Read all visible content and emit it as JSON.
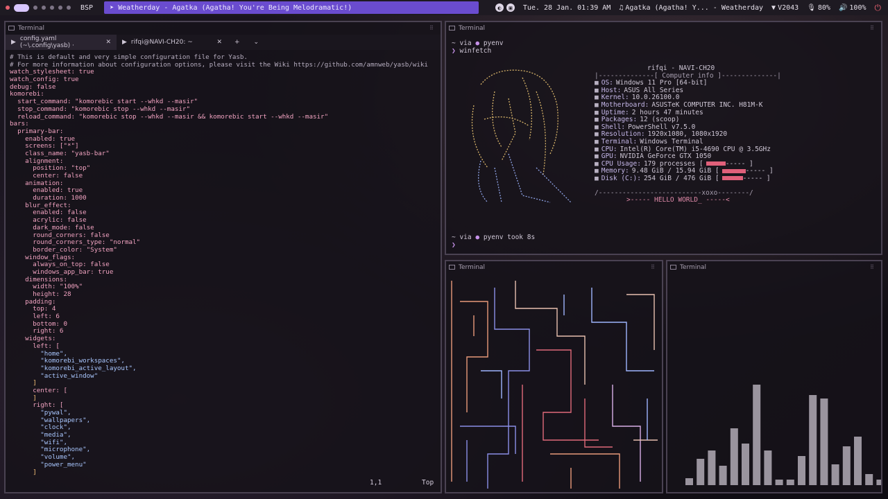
{
  "topbar": {
    "layout": "BSP",
    "active_window": "Weatherday - Agatka (Agatha! You're Being Melodramatic!)",
    "datetime": "Tue. 28 Jan. 01:39 AM",
    "media": "Agatka (Agatha! Y... - Weatherday",
    "wifi": "V2043",
    "mic": "80%",
    "volume": "100%"
  },
  "editor": {
    "title": "Terminal",
    "tabs": [
      {
        "label": "config.yaml (~\\.config\\yasb) ·"
      },
      {
        "label": "rifqi@NAVI-CH20: ~"
      }
    ],
    "lines": [
      "# This is default and very simple configuration file for Yasb.",
      "# For more information about configuration options, please visit the Wiki https://github.com/amnweb/yasb/wiki",
      "watch_stylesheet: true",
      "watch_config: true",
      "debug: false",
      "komorebi:",
      "  start_command: \"komorebic start --whkd --masir\"",
      "  stop_command: \"komorebic stop --whkd --masir\"",
      "  reload_command: \"komorebic stop --whkd --masir && komorebic start --whkd --masir\"",
      "bars:",
      "  primary-bar:",
      "    enabled: true",
      "    screens: [\"*\"]",
      "    class_name: \"yasb-bar\"",
      "    alignment:",
      "      position: \"top\"",
      "      center: false",
      "    animation:",
      "      enabled: true",
      "      duration: 1000",
      "    blur_effect:",
      "      enabled: false",
      "      acrylic: false",
      "      dark_mode: false",
      "      round_corners: false",
      "      round_corners_type: \"normal\"",
      "      border_color: \"System\"",
      "    window_flags:",
      "      always_on_top: false",
      "      windows_app_bar: true",
      "    dimensions:",
      "      width: \"100%\"",
      "      height: 28",
      "    padding:",
      "      top: 4",
      "      left: 6",
      "      bottom: 0",
      "      right: 6",
      "    widgets:",
      "      left: [",
      "        \"home\",",
      "        \"komorebi_workspaces\",",
      "        \"komorebi_active_layout\",",
      "        \"active_window\"",
      "      ]",
      "      center: [",
      "      ]",
      "      right: [",
      "        \"pywal\",",
      "        \"wallpapers\",",
      "        \"clock\",",
      "        \"media\",",
      "        \"wifi\",",
      "        \"microphone\",",
      "        \"volume\",",
      "        \"power_menu\"",
      "      ]"
    ],
    "cursor_pos": "1,1",
    "scroll_pos": "Top"
  },
  "fetch": {
    "title": "Terminal",
    "prompt1": "via",
    "env": "pyenv",
    "command": "winfetch",
    "userhost": "rifqi - NAVI-CH20",
    "header": "|--------------[ Computer info ]--------------|",
    "info": [
      {
        "label": "OS:",
        "value": "Windows 11 Pro [64-bit]"
      },
      {
        "label": "Host:",
        "value": "ASUS All Series"
      },
      {
        "label": "Kernel:",
        "value": "10.0.26100.0"
      },
      {
        "label": "Motherboard:",
        "value": "ASUSTeK COMPUTER INC. H81M-K"
      },
      {
        "label": "Uptime:",
        "value": "2 hours 47 minutes"
      },
      {
        "label": "Packages:",
        "value": "12 (scoop)"
      },
      {
        "label": "Shell:",
        "value": "PowerShell v7.5.0"
      },
      {
        "label": "Resolution:",
        "value": "1920x1080, 1080x1920"
      },
      {
        "label": "Terminal:",
        "value": "Windows Terminal"
      },
      {
        "label": "CPU:",
        "value": "Intel(R) Core(TM) i5-4690 CPU @ 3.5GHz"
      },
      {
        "label": "GPU:",
        "value": "NVIDIA GeForce GTX 1050"
      },
      {
        "label": "CPU Usage:",
        "value": "179 processes ["
      },
      {
        "label": "Memory:",
        "value": "9.48 GiB / 15.94 GiB ["
      },
      {
        "label": "Disk (C:):",
        "value": "254 GiB / 476 GiB ["
      }
    ],
    "footer_line": "/--------------------------xoxo--------/",
    "hello": ">----- HELLO WORLD_ -----<",
    "took_prefix": "via",
    "took_env": "pyenv took",
    "took_time": "8s"
  },
  "maze_term": {
    "title": "Terminal"
  },
  "viz_term": {
    "title": "Terminal"
  },
  "colors": {
    "accent": "#6a4ccf",
    "power": "#e6606f",
    "bars": "#9a949e"
  }
}
